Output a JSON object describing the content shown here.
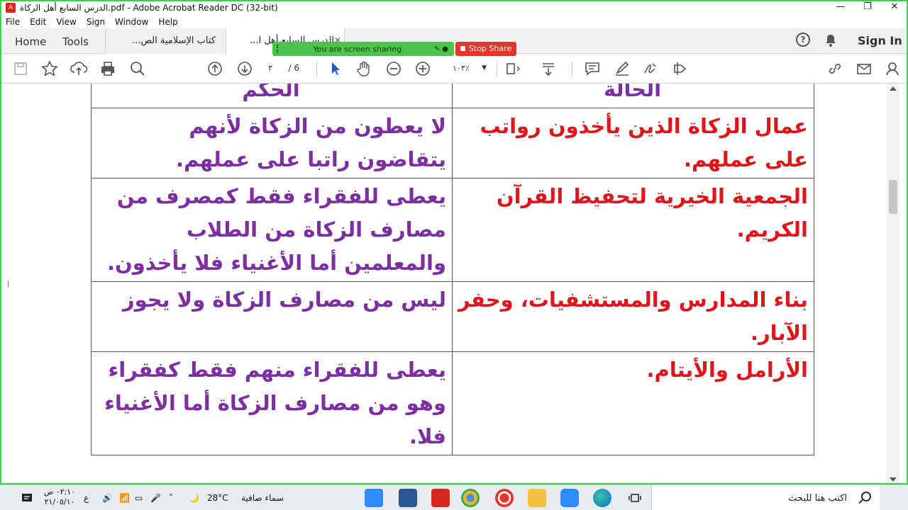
{
  "window": {
    "title": "الدرس السابع أهل الزكاة.pdf - Adobe Acrobat Reader DC (32-bit)",
    "icon": "pdf-icon",
    "controls": {
      "minimize": "—",
      "maximize": "❐",
      "close": "✕"
    }
  },
  "menu": [
    "File",
    "Edit",
    "View",
    "Sign",
    "Window",
    "Help"
  ],
  "tabs": {
    "home": "Home",
    "tools": "Tools",
    "documents": [
      {
        "label": "كتاب الإسلامية الص...",
        "active": false
      },
      {
        "label": "الدرس السابع أهل ا...",
        "active": true,
        "close": "✕"
      }
    ]
  },
  "header_right": {
    "help": "?",
    "sign_in": "Sign In"
  },
  "screen_share": {
    "status": "You are screen sharing",
    "stop": "Stop Share",
    "color": "#4cc34d",
    "stop_color": "#e8352c"
  },
  "toolbar": {
    "icons": [
      "save-icon",
      "bookmark-star-icon",
      "upload-icon",
      "print-icon",
      "search-zoom-icon",
      "prev-page-icon",
      "next-page-icon",
      "select-cursor-icon",
      "hand-icon",
      "zoom-out-icon",
      "zoom-in-icon",
      "page-fit-icon",
      "scroll-mode-icon",
      "comment-icon",
      "highlight-pen-icon",
      "sign-icon",
      "share-icon",
      "link-icon",
      "email-icon",
      "user-icon"
    ],
    "page_current": "٢",
    "page_total": "/ 6",
    "zoom": "١٠٣٪"
  },
  "table": {
    "header": {
      "case": "الحالة",
      "ruling": "الحكم"
    },
    "rows": [
      {
        "case": "عمال الزكاة الذين يأخذون رواتب على عملهم.",
        "ruling": "لا يعطون من الزكاة لأنهم يتقاضون راتبا على عملهم."
      },
      {
        "case": "الجمعية الخيرية لتحفيظ القرآن الكريم.",
        "ruling": "يعطى للفقراء فقط كمصرف من مصارف الزكاة من الطلاب والمعلمين أما الأغنياء فلا يأخذون."
      },
      {
        "case": "بناء المدارس والمستشفيات، وحفر الآبار.",
        "ruling": "ليس من مصارف الزكاة ولا يجوز"
      },
      {
        "case": "الأرامل والأيتام.",
        "ruling": "يعطى للفقراء منهم فقط كفقراء وهو من مصارف الزكاة أما الأغنياء فلا."
      }
    ],
    "colors": {
      "case": "#e0141b",
      "ruling": "#7b2fa0"
    }
  },
  "taskbar": {
    "search_placeholder": "اكتب هنا للبحث",
    "weather_text": "سماء صافية",
    "temperature": "28°C",
    "language": "ع",
    "time": "٠٢:١٠ ص",
    "date": "٢١/٠٥/١٠",
    "apps": [
      "zoom-app-icon",
      "word-app-icon",
      "acrobat-app-icon",
      "chrome-app-icon",
      "recorder-app-icon",
      "file-explorer-app-icon",
      "zoom-meeting-app-icon",
      "edge-app-icon",
      "task-view-icon"
    ]
  }
}
